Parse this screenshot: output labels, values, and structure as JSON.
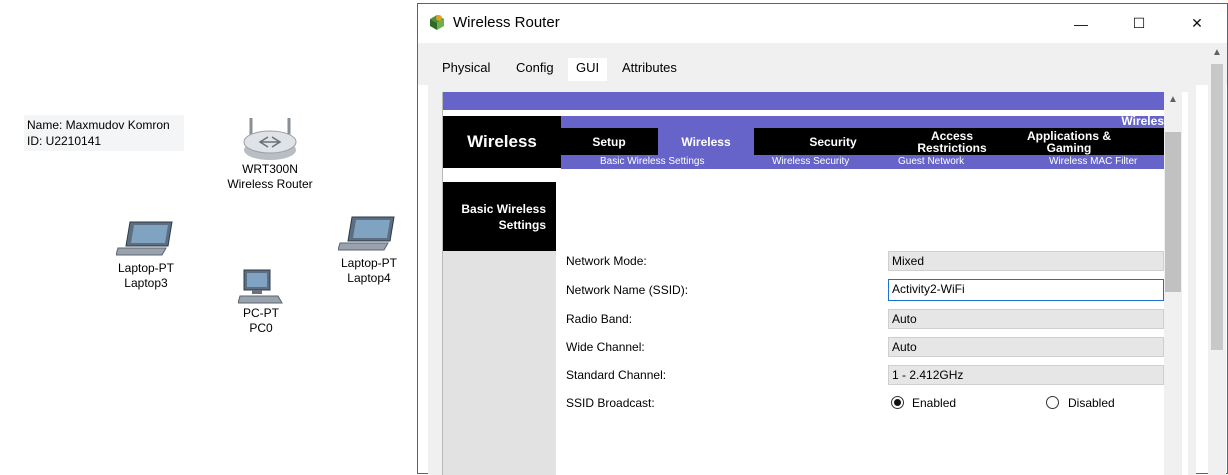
{
  "workspace": {
    "note": {
      "name_line": "Name: Maxmudov Komron",
      "id_line": "ID: U2210141"
    },
    "devices": [
      {
        "line1": "WRT300N",
        "line2": "Wireless Router"
      },
      {
        "line1": "Laptop-PT",
        "line2": "Laptop3"
      },
      {
        "line1": "PC-PT",
        "line2": "PC0"
      },
      {
        "line1": "Laptop-PT",
        "line2": "Laptop4"
      }
    ]
  },
  "dialog": {
    "title": "Wireless Router",
    "window_buttons": {
      "minimize": "—",
      "maximize": "☐",
      "close": "✕"
    },
    "tabs": [
      "Physical",
      "Config",
      "GUI",
      "Attributes"
    ],
    "active_tab": "GUI"
  },
  "router": {
    "brand_header": "Wireless",
    "corner_label": "Wireles",
    "nav": [
      "Setup",
      "Wireless",
      "Security",
      "Access Restrictions",
      "Applications & Gaming"
    ],
    "nav_active": "Wireless",
    "subnav": [
      "Basic Wireless Settings",
      "Wireless Security",
      "Guest Network",
      "Wireless MAC Filter"
    ],
    "section_title": "Basic Wireless Settings",
    "fields": [
      {
        "label": "Network Mode:",
        "value": "Mixed"
      },
      {
        "label": "Network Name (SSID):",
        "value": "Activity2-WiFi"
      },
      {
        "label": "Radio Band:",
        "value": "Auto"
      },
      {
        "label": "Wide Channel:",
        "value": "Auto"
      },
      {
        "label": "Standard Channel:",
        "value": "1 - 2.412GHz"
      }
    ],
    "ssid_broadcast": {
      "label": "SSID Broadcast:",
      "options": [
        "Enabled",
        "Disabled"
      ],
      "selected": "Enabled"
    }
  },
  "colors": {
    "purple": "#6664c8",
    "black": "#000000",
    "title_border": "#1e6fd0"
  }
}
